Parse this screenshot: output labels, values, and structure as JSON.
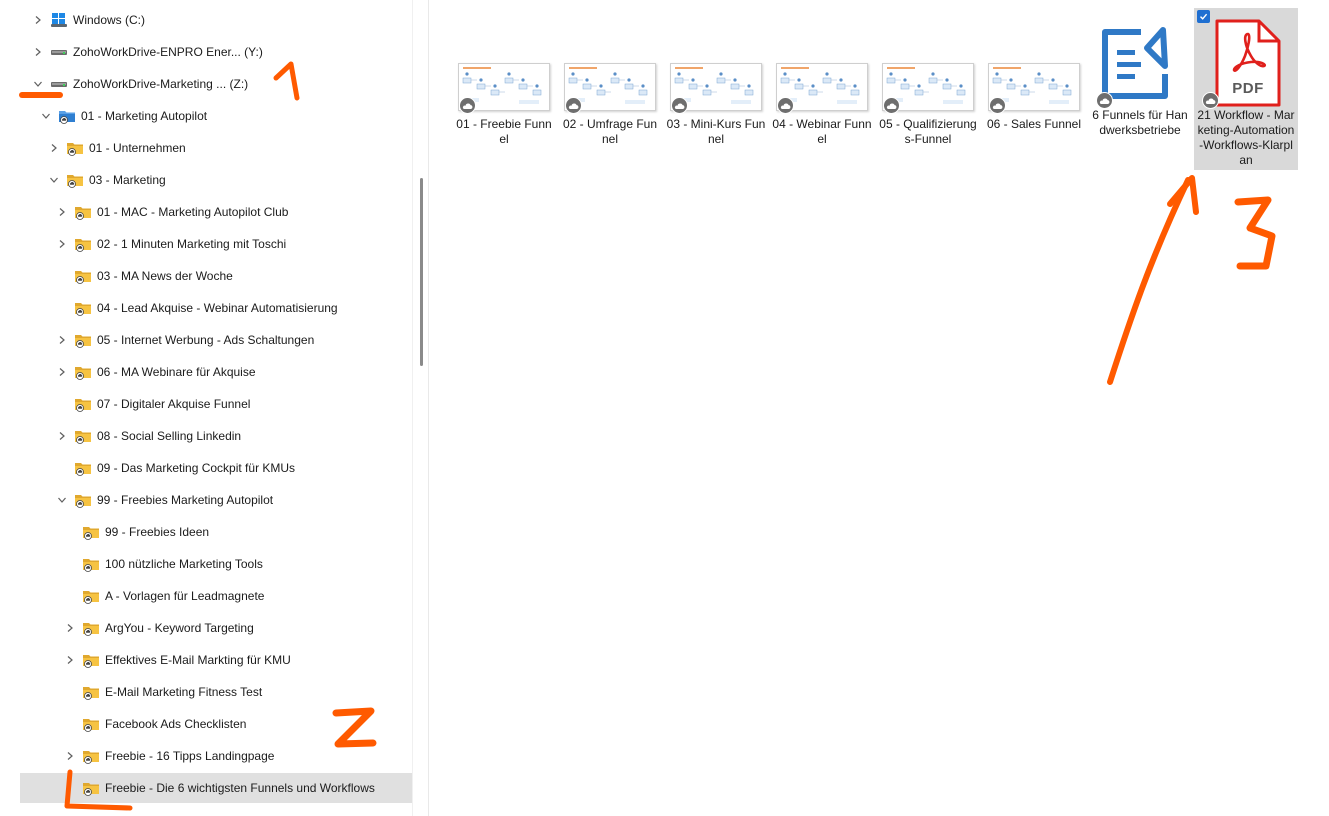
{
  "nav": {
    "items": [
      {
        "label": "Windows  (C:)",
        "icon": "windows-drive-icon",
        "chevron": "right",
        "indent": 0
      },
      {
        "label": "ZohoWorkDrive-ENPRO Ener... (Y:)",
        "icon": "network-drive-icon",
        "chevron": "right",
        "indent": 0
      },
      {
        "label": "ZohoWorkDrive-Marketing ... (Z:)",
        "icon": "network-drive-icon",
        "chevron": "down",
        "indent": 0
      },
      {
        "label": "01 - Marketing Autopilot",
        "icon": "cloud-folder-icon",
        "chevron": "down",
        "indent": 1
      },
      {
        "label": "01 - Unternehmen",
        "icon": "folder-icon",
        "chevron": "right",
        "indent": 2
      },
      {
        "label": "03 - Marketing",
        "icon": "folder-icon",
        "chevron": "down",
        "indent": 2
      },
      {
        "label": "01 - MAC - Marketing Autopilot Club",
        "icon": "folder-icon",
        "chevron": "right",
        "indent": 3
      },
      {
        "label": "02 - 1 Minuten Marketing mit Toschi",
        "icon": "folder-icon",
        "chevron": "right",
        "indent": 3
      },
      {
        "label": "03 - MA News der Woche",
        "icon": "folder-icon",
        "chevron": "none",
        "indent": 3
      },
      {
        "label": "04 - Lead Akquise - Webinar Automatisierung",
        "icon": "folder-icon",
        "chevron": "none",
        "indent": 3
      },
      {
        "label": "05 - Internet Werbung - Ads Schaltungen",
        "icon": "folder-icon",
        "chevron": "right",
        "indent": 3
      },
      {
        "label": "06 - MA Webinare für Akquise",
        "icon": "folder-icon",
        "chevron": "right",
        "indent": 3
      },
      {
        "label": "07 - Digitaler Akquise Funnel",
        "icon": "folder-icon",
        "chevron": "none",
        "indent": 3
      },
      {
        "label": "08 - Social Selling Linkedin",
        "icon": "folder-icon",
        "chevron": "right",
        "indent": 3
      },
      {
        "label": "09 - Das Marketing Cockpit für KMUs",
        "icon": "folder-icon",
        "chevron": "none",
        "indent": 3
      },
      {
        "label": "99 - Freebies Marketing Autopilot",
        "icon": "folder-icon",
        "chevron": "down",
        "indent": 3
      },
      {
        "label": "99 - Freebies Ideen",
        "icon": "folder-icon",
        "chevron": "none",
        "indent": 4
      },
      {
        "label": "100 nützliche Marketing Tools",
        "icon": "folder-icon",
        "chevron": "none",
        "indent": 4
      },
      {
        "label": "A - Vorlagen für Leadmagnete",
        "icon": "folder-icon",
        "chevron": "none",
        "indent": 4
      },
      {
        "label": "ArgYou - Keyword Targeting",
        "icon": "folder-icon",
        "chevron": "right",
        "indent": 4
      },
      {
        "label": "Effektives E-Mail Markting für KMU",
        "icon": "folder-icon",
        "chevron": "right",
        "indent": 4
      },
      {
        "label": "E-Mail Marketing Fitness Test",
        "icon": "folder-icon",
        "chevron": "none",
        "indent": 4
      },
      {
        "label": "Facebook Ads Checklisten",
        "icon": "folder-icon",
        "chevron": "none",
        "indent": 4
      },
      {
        "label": "Freebie - 16 Tipps Landingpage",
        "icon": "folder-icon",
        "chevron": "right",
        "indent": 4
      },
      {
        "label": "Freebie - Die 6 wichtigsten Funnels und Workflows",
        "icon": "folder-icon",
        "chevron": "none",
        "indent": 4,
        "selected": true
      }
    ]
  },
  "files": [
    {
      "name": "01 - Freebie Funnel",
      "type": "diagram-thumbnail",
      "selected": false
    },
    {
      "name": "02 - Umfrage Funnel",
      "type": "diagram-thumbnail",
      "selected": false
    },
    {
      "name": "03 - Mini-Kurs Funnel",
      "type": "diagram-thumbnail",
      "selected": false
    },
    {
      "name": "04 - Webinar Funnel",
      "type": "diagram-thumbnail",
      "selected": false
    },
    {
      "name": "05 - Qualifizierungs-Funnel",
      "type": "diagram-thumbnail",
      "selected": false
    },
    {
      "name": "06 - Sales Funnel",
      "type": "diagram-thumbnail",
      "selected": false
    },
    {
      "name": "6 Funnels für Handwerksbetriebe",
      "type": "flow-app-icon",
      "selected": false
    },
    {
      "name": "21 Workflow - Marketing-Automation-Workflows-Klarplan",
      "type": "pdf-icon",
      "selected": true,
      "icon_text": "PDF"
    }
  ],
  "colors": {
    "annotation": "#ff5a00",
    "selection": "#d9d9d9",
    "pdf_red": "#e0201c",
    "flow_blue": "#2f79c6",
    "folder": "#f6c342"
  },
  "annotations": [
    "1",
    "2",
    "3"
  ]
}
